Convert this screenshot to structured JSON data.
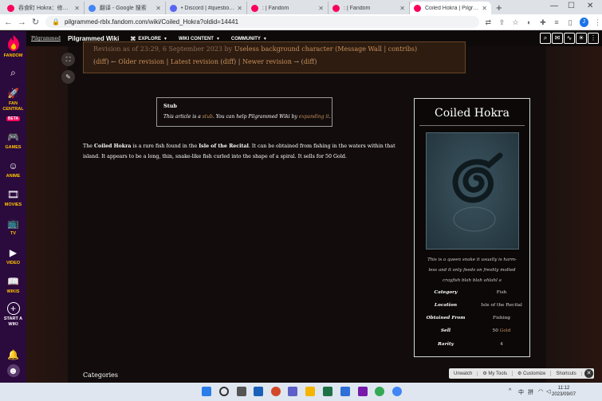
{
  "browser": {
    "tabs": [
      {
        "title": "吞食町 Hokra：修订历史",
        "color": "#fa005a",
        "active": false
      },
      {
        "title": "翻译 - Google 搜索",
        "color": "#4285f4",
        "active": false
      },
      {
        "title": "• Discord | #questions",
        "color": "#5865f2",
        "active": false
      },
      {
        "title": ": | Fandom",
        "color": "#fa005a",
        "active": false
      },
      {
        "title": ": | Fandom",
        "color": "#fa005a",
        "active": false
      },
      {
        "title": "Coiled Hokra | Pilgramme",
        "color": "#fa005a",
        "active": true
      }
    ],
    "url": "pilgrammed-rblx.fandom.com/wiki/Coiled_Hokra?oldid=14441",
    "profile_initial": "J"
  },
  "rail": {
    "brand": "FANDOM",
    "fan_central": "FAN CENTRAL",
    "beta": "BETA",
    "games": "GAMES",
    "anime": "ANIME",
    "movies": "MOVIES",
    "tv": "TV",
    "video": "VIDEO",
    "wikis": "WIKIS",
    "start_wiki": "START A WIKI"
  },
  "wiki_header": {
    "logo_text": "Pilgrammed",
    "wiki_name": "Pilgrammed Wiki",
    "nav": [
      "EXPLORE",
      "WIKI CONTENT",
      "COMMUNITY"
    ]
  },
  "revision": {
    "line1_prefix": "Revision as of 23:29, 6 September 2023 by",
    "line1_user": "Useless background character",
    "line1_links": "(Message Wall | contribs)",
    "diff": "diff",
    "older": "Older revision",
    "latest": "Latest revision",
    "newer": "Newer revision"
  },
  "stub": {
    "title": "Stub",
    "text_before": "This article is a",
    "text_link1": "stub",
    "text_mid": ". You can help Pilgrammed Wiki by",
    "text_link2": "expanding it",
    "text_end": "."
  },
  "article": {
    "p1": "The",
    "name": "Coiled Hokra",
    "p2": "is a rare fish found in the",
    "place": "Isle of the Recital",
    "p3": ". It can be obtained from fishing in the waters within that island. It appears to be a long, thin, snake-like fish curled into the shape of a spiral. It sells for 50 Gold."
  },
  "infobox": {
    "title": "Coiled Hokra",
    "caption": "This is a queen snake it usually is harm-less and it only feeds on freshly molted crayfish blah blah ahlahl a",
    "rows": [
      {
        "k": "Category",
        "v": "Fish"
      },
      {
        "k": "Location",
        "v": "Isle of the Recital"
      },
      {
        "k": "Obtained From",
        "v": "Fishing"
      },
      {
        "k": "Sell",
        "v_num": "50",
        "v_unit": "Gold"
      },
      {
        "k": "Rarity",
        "v": "4"
      }
    ]
  },
  "categories_label": "Categories",
  "toolbar": {
    "unwatch": "Unwatch",
    "my_tools": "My Tools",
    "customize": "Customize",
    "shortcuts": "Shortcuts"
  },
  "taskbar": {
    "time": "11:12",
    "date": "2023/09/07",
    "ime": "中",
    "ime2": "拼"
  }
}
